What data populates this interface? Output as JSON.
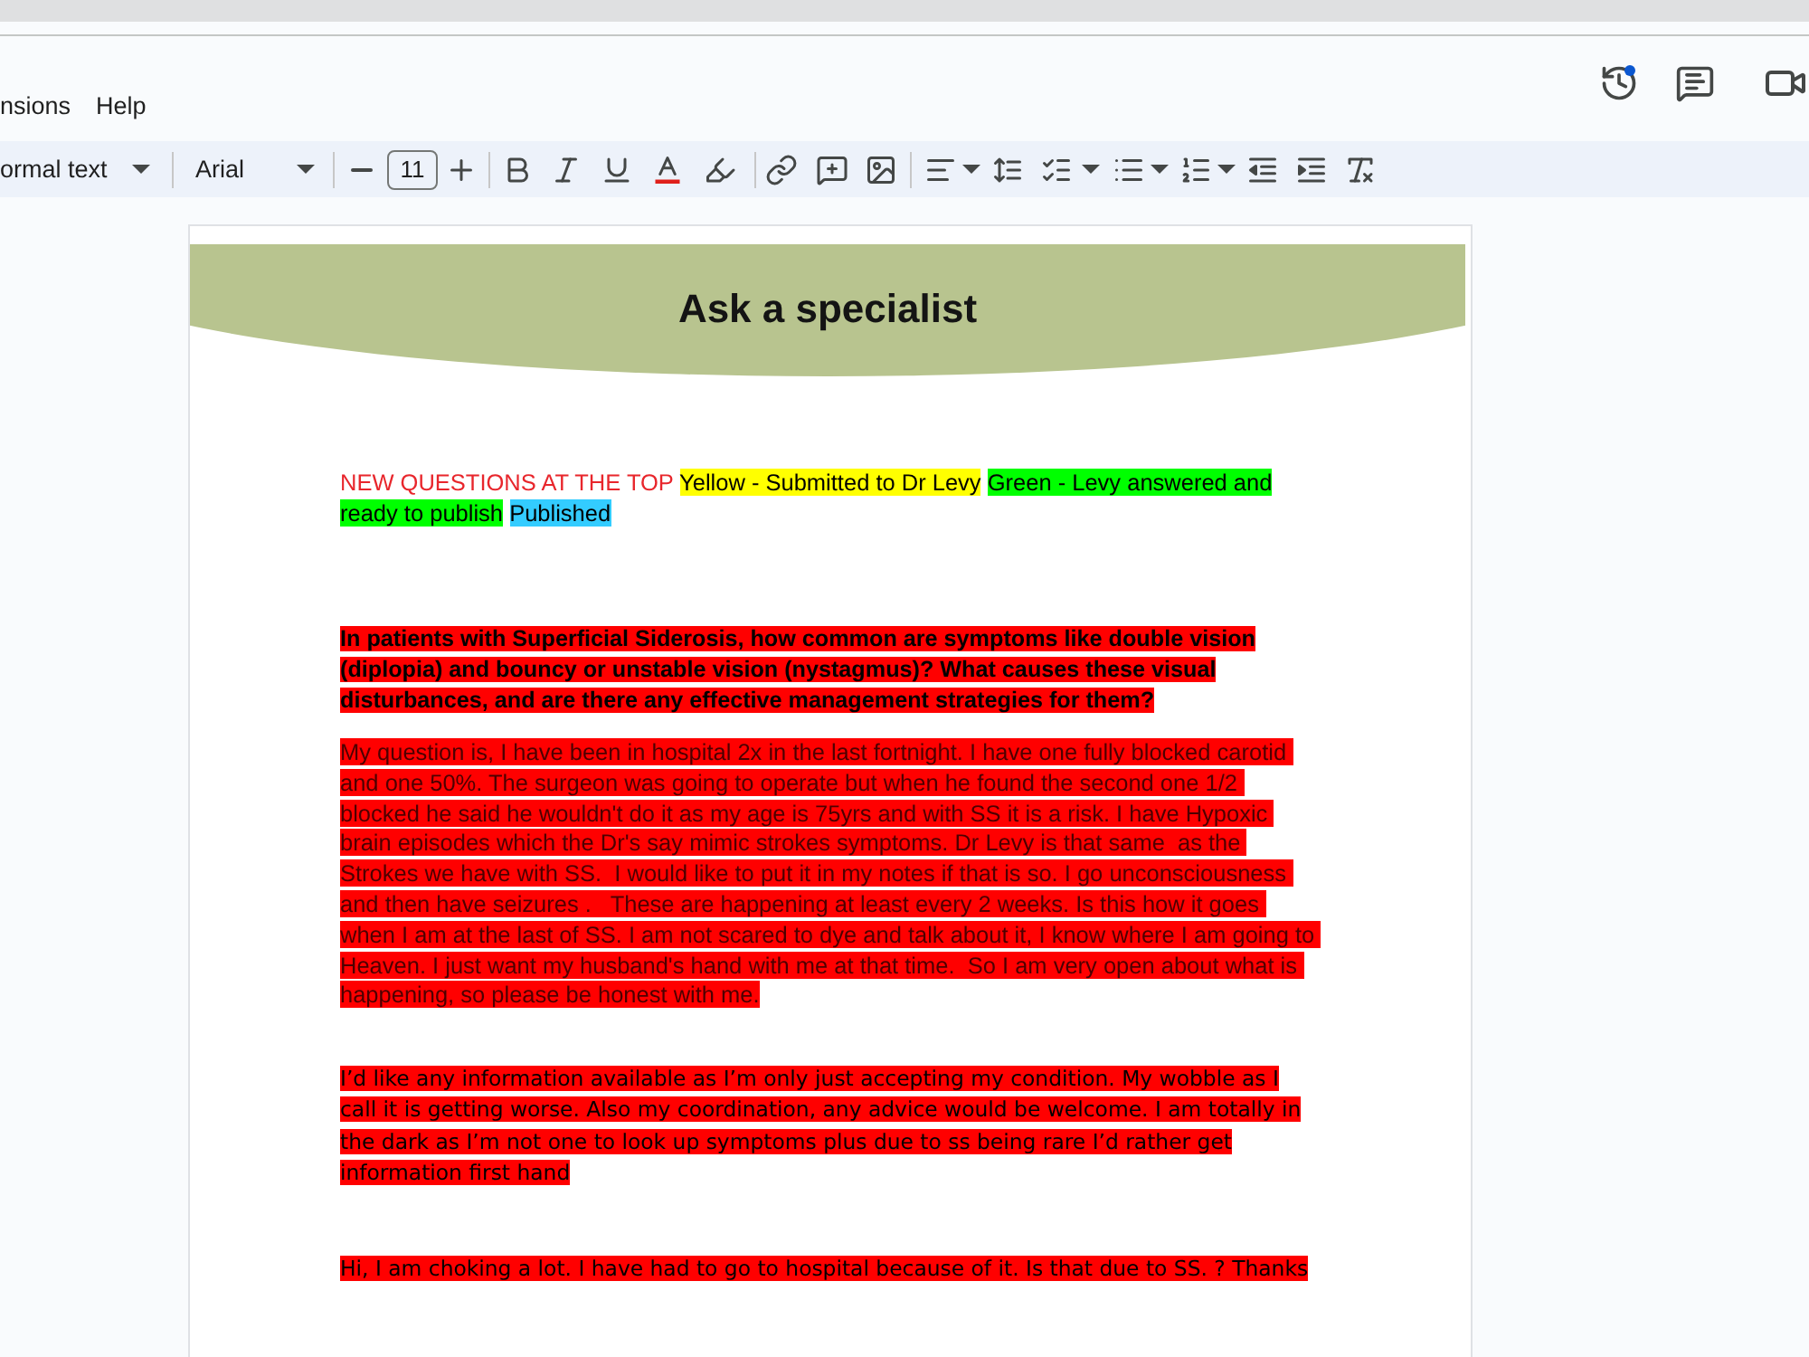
{
  "menu_bar": {
    "items": [
      "nsions",
      "Help"
    ]
  },
  "header_actions": {
    "version_history_badge": true
  },
  "toolbar": {
    "paragraph_style": "ormal text",
    "font": "Arial",
    "font_size": "11"
  },
  "document": {
    "banner_title": "Ask a specialist",
    "legend": [
      {
        "kind": "text",
        "text": "NEW QUESTIONS AT THE TOP",
        "color": "#e8262c"
      },
      {
        "kind": "highlight",
        "text": "Yellow - Submitted to Dr Levy",
        "color": "#ffff00"
      },
      {
        "kind": "highlight",
        "text": "Green - Levy answered and ready to publish",
        "color": "#00ff00"
      },
      {
        "kind": "highlight",
        "text": "Published",
        "color": "#33ccff"
      }
    ],
    "questions": [
      {
        "kind": "semibold",
        "color": "#ff0000",
        "text": "In patients with Superficial Siderosis, how common are symptoms like double vision (diplopia) and bouncy or unstable vision (nystagmus)? What causes these visual disturbances, and are there any effective management strategies for them?"
      },
      {
        "kind": "arial",
        "color": "#ff0000",
        "text": "My question is, I have been in hospital 2x in the last fortnight. I have one fully blocked carotid and one 50%. The surgeon was going to operate but when he found the second one 1/2 blocked he said he wouldn't do it as my age is 75yrs and with SS it is a risk. I have Hypoxic brain episodes which the Dr's say mimic strokes symptoms. Dr Levy is that same  as the Strokes we have with SS.  I would like to put it in my notes if that is so. I go unconsciousness and then have seizures .   These are happening at least every 2 weeks. Is this how it goes when I am at the last of SS. I am not scared to dye and talk about it, I know where I am going to Heaven. I just want my husband's hand with me at that time.  So I am very open about what is happening, so please be honest with me."
      },
      {
        "kind": "regular",
        "color": "#ff0000",
        "text": "I’d like any information available as I’m only just accepting my condition. My wobble as I call it is getting worse. Also my coordination, any advice would be welcome. I am totally in the dark as I’m not one to look up symptoms plus due to ss being rare I’d rather get information first hand"
      },
      {
        "kind": "regular",
        "color": "#ff0000",
        "text": "Hi, I am choking a lot. I have had to go to hospital because of it. Is that due to SS. ? Thanks"
      }
    ]
  }
}
